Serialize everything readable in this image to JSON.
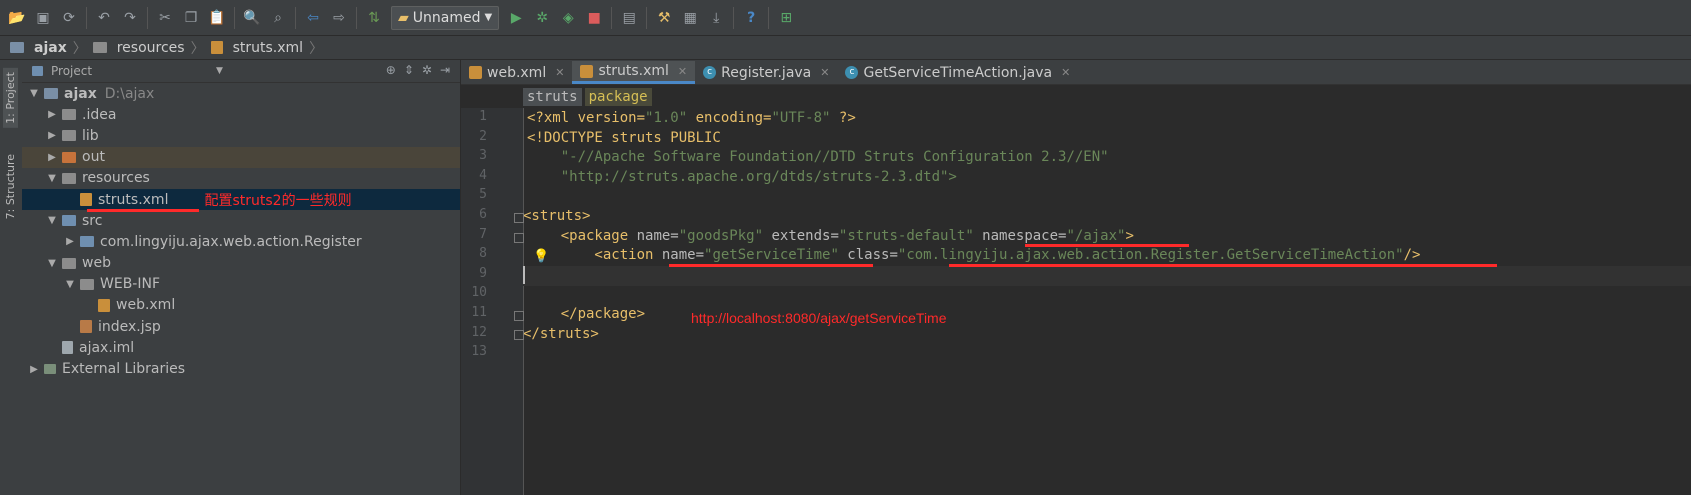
{
  "toolbar": {
    "run_config": "Unnamed",
    "icons": [
      "open-icon",
      "save-icon",
      "sync-icon",
      "undo-icon",
      "redo-icon",
      "cut-icon",
      "copy-icon",
      "paste-icon",
      "find-icon",
      "replace-icon",
      "back-icon",
      "forward-icon",
      "build-icon",
      "run-icon",
      "debug-icon",
      "coverage-icon",
      "stop-icon",
      "project-structure-icon",
      "settings-icon",
      "sdk-icon",
      "help-icon",
      "vcs-icon"
    ]
  },
  "breadcrumb": {
    "items": [
      "ajax",
      "resources",
      "struts.xml"
    ]
  },
  "left_tabs": {
    "project": "1: Project",
    "structure": "7: Structure"
  },
  "project_panel": {
    "title": "Project",
    "tree": [
      {
        "label": "ajax",
        "extra": "D:\\ajax",
        "depth": 0,
        "expanded": true,
        "icon": "module"
      },
      {
        "label": ".idea",
        "depth": 1,
        "expanded": false,
        "icon": "folder"
      },
      {
        "label": "lib",
        "depth": 1,
        "expanded": false,
        "icon": "folder"
      },
      {
        "label": "out",
        "depth": 1,
        "expanded": false,
        "icon": "folder-orange"
      },
      {
        "label": "resources",
        "depth": 1,
        "expanded": true,
        "icon": "folder"
      },
      {
        "label": "struts.xml",
        "depth": 2,
        "icon": "xml",
        "note": "配置struts2的一些规则"
      },
      {
        "label": "src",
        "depth": 1,
        "expanded": true,
        "icon": "folder-blue"
      },
      {
        "label": "com.lingyiju.ajax.web.action.Register",
        "depth": 2,
        "expanded": false,
        "icon": "package"
      },
      {
        "label": "web",
        "depth": 1,
        "expanded": true,
        "icon": "folder"
      },
      {
        "label": "WEB-INF",
        "depth": 2,
        "expanded": true,
        "icon": "folder"
      },
      {
        "label": "web.xml",
        "depth": 3,
        "icon": "xml"
      },
      {
        "label": "index.jsp",
        "depth": 2,
        "icon": "jsp"
      },
      {
        "label": "ajax.iml",
        "depth": 1,
        "icon": "iml"
      },
      {
        "label": "External Libraries",
        "depth": 0,
        "expanded": false,
        "icon": "library"
      }
    ]
  },
  "editor": {
    "tabs": [
      {
        "label": "web.xml",
        "icon": "xml",
        "active": false
      },
      {
        "label": "struts.xml",
        "icon": "xml",
        "active": true
      },
      {
        "label": "Register.java",
        "icon": "java",
        "active": false
      },
      {
        "label": "GetServiceTimeAction.java",
        "icon": "java",
        "active": false
      }
    ],
    "xml_crumbs": [
      "struts",
      "package"
    ],
    "line_numbers": [
      "1",
      "2",
      "3",
      "4",
      "5",
      "6",
      "7",
      "8",
      "9",
      "10",
      "11",
      "12",
      "13"
    ],
    "code": {
      "l1_a": "<?xml version=",
      "l1_b": "\"1.0\"",
      "l1_c": " encoding=",
      "l1_d": "\"UTF-8\"",
      "l1_e": " ?>",
      "l2": "<!DOCTYPE struts PUBLIC",
      "l3": "    \"-//Apache Software Foundation//DTD Struts Configuration 2.3//EN\"",
      "l4": "    \"http://struts.apache.org/dtds/struts-2.3.dtd\">",
      "l6": "<struts>",
      "l7_a": "    <package",
      "l7_b": " name=",
      "l7_c": "\"goodsPkg\"",
      "l7_d": " extends=",
      "l7_e": "\"struts-default\"",
      "l7_f": " namespace=",
      "l7_g": "\"/ajax\"",
      "l7_h": ">",
      "l8_a": "        <action",
      "l8_b": " name=",
      "l8_c": "\"getServiceTime\"",
      "l8_d": " class=",
      "l8_e": "\"com.lingyiju.ajax.web.action.Register.GetServiceTimeAction\"",
      "l8_f": "/>",
      "l11": "    </package>",
      "l12": "</struts>"
    },
    "url_annotation": "http://localhost:8080/ajax/getServiceTime"
  },
  "colors": {
    "annotation": "#ff2a2a",
    "tag": "#e8bf6a",
    "string": "#6a8759",
    "selection": "#0d293e"
  }
}
